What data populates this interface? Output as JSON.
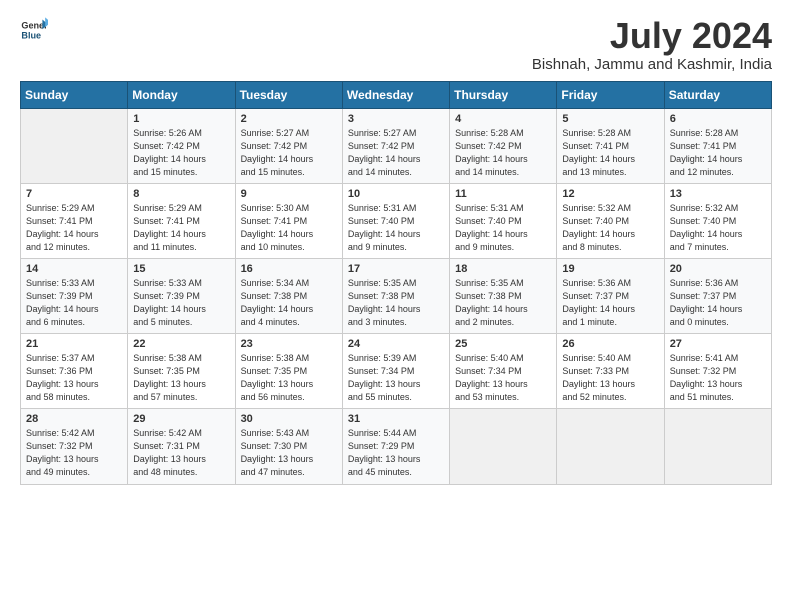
{
  "header": {
    "logo_general": "General",
    "logo_blue": "Blue",
    "month": "July 2024",
    "location": "Bishnah, Jammu and Kashmir, India"
  },
  "weekdays": [
    "Sunday",
    "Monday",
    "Tuesday",
    "Wednesday",
    "Thursday",
    "Friday",
    "Saturday"
  ],
  "weeks": [
    [
      {
        "day": "",
        "info": ""
      },
      {
        "day": "1",
        "info": "Sunrise: 5:26 AM\nSunset: 7:42 PM\nDaylight: 14 hours\nand 15 minutes."
      },
      {
        "day": "2",
        "info": "Sunrise: 5:27 AM\nSunset: 7:42 PM\nDaylight: 14 hours\nand 15 minutes."
      },
      {
        "day": "3",
        "info": "Sunrise: 5:27 AM\nSunset: 7:42 PM\nDaylight: 14 hours\nand 14 minutes."
      },
      {
        "day": "4",
        "info": "Sunrise: 5:28 AM\nSunset: 7:42 PM\nDaylight: 14 hours\nand 14 minutes."
      },
      {
        "day": "5",
        "info": "Sunrise: 5:28 AM\nSunset: 7:41 PM\nDaylight: 14 hours\nand 13 minutes."
      },
      {
        "day": "6",
        "info": "Sunrise: 5:28 AM\nSunset: 7:41 PM\nDaylight: 14 hours\nand 12 minutes."
      }
    ],
    [
      {
        "day": "7",
        "info": "Sunrise: 5:29 AM\nSunset: 7:41 PM\nDaylight: 14 hours\nand 12 minutes."
      },
      {
        "day": "8",
        "info": "Sunrise: 5:29 AM\nSunset: 7:41 PM\nDaylight: 14 hours\nand 11 minutes."
      },
      {
        "day": "9",
        "info": "Sunrise: 5:30 AM\nSunset: 7:41 PM\nDaylight: 14 hours\nand 10 minutes."
      },
      {
        "day": "10",
        "info": "Sunrise: 5:31 AM\nSunset: 7:40 PM\nDaylight: 14 hours\nand 9 minutes."
      },
      {
        "day": "11",
        "info": "Sunrise: 5:31 AM\nSunset: 7:40 PM\nDaylight: 14 hours\nand 9 minutes."
      },
      {
        "day": "12",
        "info": "Sunrise: 5:32 AM\nSunset: 7:40 PM\nDaylight: 14 hours\nand 8 minutes."
      },
      {
        "day": "13",
        "info": "Sunrise: 5:32 AM\nSunset: 7:40 PM\nDaylight: 14 hours\nand 7 minutes."
      }
    ],
    [
      {
        "day": "14",
        "info": "Sunrise: 5:33 AM\nSunset: 7:39 PM\nDaylight: 14 hours\nand 6 minutes."
      },
      {
        "day": "15",
        "info": "Sunrise: 5:33 AM\nSunset: 7:39 PM\nDaylight: 14 hours\nand 5 minutes."
      },
      {
        "day": "16",
        "info": "Sunrise: 5:34 AM\nSunset: 7:38 PM\nDaylight: 14 hours\nand 4 minutes."
      },
      {
        "day": "17",
        "info": "Sunrise: 5:35 AM\nSunset: 7:38 PM\nDaylight: 14 hours\nand 3 minutes."
      },
      {
        "day": "18",
        "info": "Sunrise: 5:35 AM\nSunset: 7:38 PM\nDaylight: 14 hours\nand 2 minutes."
      },
      {
        "day": "19",
        "info": "Sunrise: 5:36 AM\nSunset: 7:37 PM\nDaylight: 14 hours\nand 1 minute."
      },
      {
        "day": "20",
        "info": "Sunrise: 5:36 AM\nSunset: 7:37 PM\nDaylight: 14 hours\nand 0 minutes."
      }
    ],
    [
      {
        "day": "21",
        "info": "Sunrise: 5:37 AM\nSunset: 7:36 PM\nDaylight: 13 hours\nand 58 minutes."
      },
      {
        "day": "22",
        "info": "Sunrise: 5:38 AM\nSunset: 7:35 PM\nDaylight: 13 hours\nand 57 minutes."
      },
      {
        "day": "23",
        "info": "Sunrise: 5:38 AM\nSunset: 7:35 PM\nDaylight: 13 hours\nand 56 minutes."
      },
      {
        "day": "24",
        "info": "Sunrise: 5:39 AM\nSunset: 7:34 PM\nDaylight: 13 hours\nand 55 minutes."
      },
      {
        "day": "25",
        "info": "Sunrise: 5:40 AM\nSunset: 7:34 PM\nDaylight: 13 hours\nand 53 minutes."
      },
      {
        "day": "26",
        "info": "Sunrise: 5:40 AM\nSunset: 7:33 PM\nDaylight: 13 hours\nand 52 minutes."
      },
      {
        "day": "27",
        "info": "Sunrise: 5:41 AM\nSunset: 7:32 PM\nDaylight: 13 hours\nand 51 minutes."
      }
    ],
    [
      {
        "day": "28",
        "info": "Sunrise: 5:42 AM\nSunset: 7:32 PM\nDaylight: 13 hours\nand 49 minutes."
      },
      {
        "day": "29",
        "info": "Sunrise: 5:42 AM\nSunset: 7:31 PM\nDaylight: 13 hours\nand 48 minutes."
      },
      {
        "day": "30",
        "info": "Sunrise: 5:43 AM\nSunset: 7:30 PM\nDaylight: 13 hours\nand 47 minutes."
      },
      {
        "day": "31",
        "info": "Sunrise: 5:44 AM\nSunset: 7:29 PM\nDaylight: 13 hours\nand 45 minutes."
      },
      {
        "day": "",
        "info": ""
      },
      {
        "day": "",
        "info": ""
      },
      {
        "day": "",
        "info": ""
      }
    ]
  ]
}
